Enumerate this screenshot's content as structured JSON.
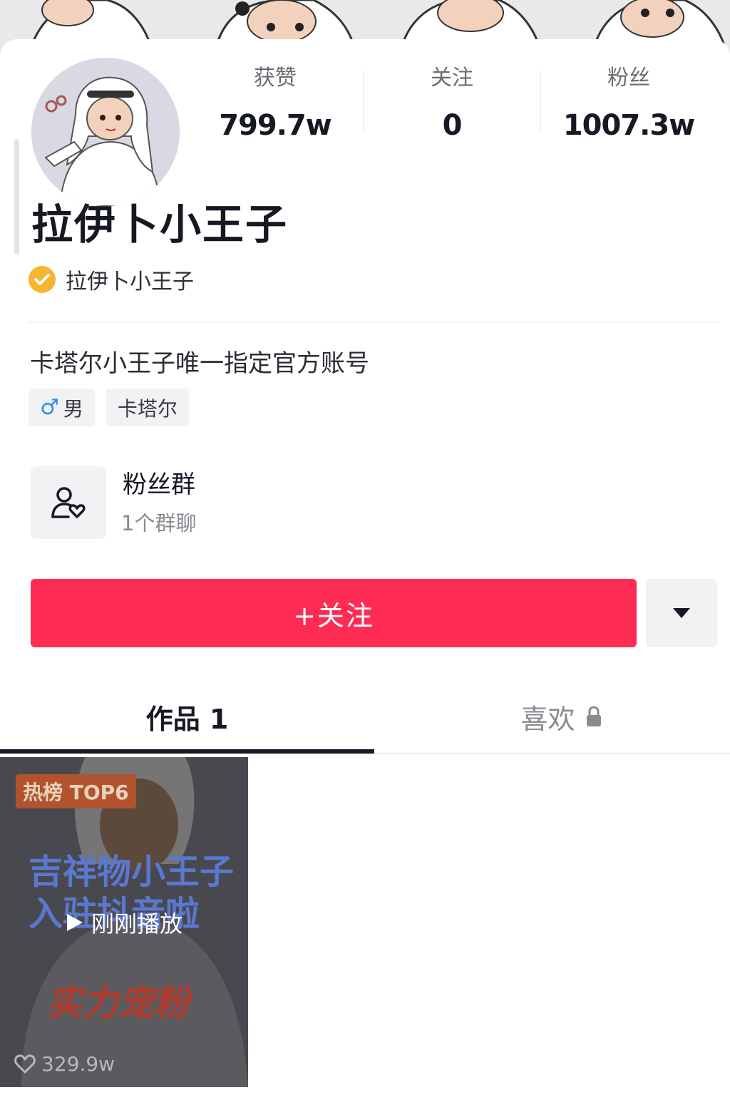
{
  "profile": {
    "nickname": "拉伊卜小王子",
    "verified_label": "拉伊卜小王子",
    "bio": "卡塔尔小王子唯一指定官方账号",
    "tags": [
      {
        "icon": "male-symbol-icon",
        "glyph": "♂",
        "label": "男"
      },
      {
        "label": "卡塔尔"
      }
    ]
  },
  "stats": [
    {
      "label": "获赞",
      "value": "799.7w"
    },
    {
      "label": "关注",
      "value": "0"
    },
    {
      "label": "粉丝",
      "value": "1007.3w"
    }
  ],
  "fan_group": {
    "title": "粉丝群",
    "subtitle": "1个群聊"
  },
  "actions": {
    "follow_label": "+关注",
    "more_icon": "caret-down-icon"
  },
  "tabs": {
    "works": "作品 1",
    "likes": "喜欢",
    "likes_icon": "lock-icon"
  },
  "video": {
    "hot_badge": "热榜 TOP6",
    "cover_line1": "吉祥物小王子",
    "cover_line2": "入驻抖音啦",
    "cover_line3": "实力宠粉",
    "status": "刚刚播放",
    "likes": "329.9w"
  },
  "colors": {
    "accent": "#fe2c55",
    "verify": "#f5b530",
    "male": "#2e8cf0"
  }
}
